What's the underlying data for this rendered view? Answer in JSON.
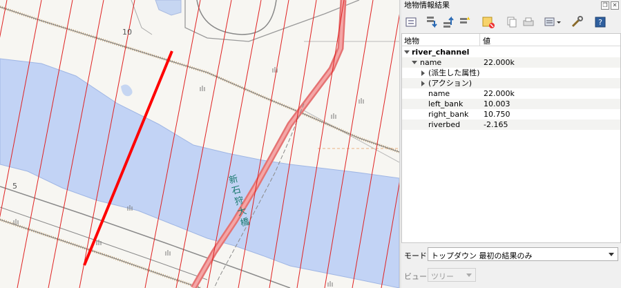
{
  "map": {
    "label_10": "10",
    "label_5": "5",
    "bridge_label": "新石狩大橋"
  },
  "panel": {
    "title": "地物情報結果",
    "toolbar_icons": [
      "expand-tree-icon",
      "expand-all-icon",
      "collapse-all-icon",
      "expand-new-icon",
      "deselect-icon",
      "copy-icon",
      "print-icon",
      "identify-settings-icon",
      "help-icon"
    ],
    "columns": {
      "feature": "地物",
      "value": "値"
    },
    "layer": "river_channel",
    "feature_row": {
      "key": "name",
      "value": "22.000k"
    },
    "derived": "(派生した属性)",
    "actions": "(アクション)",
    "attributes": [
      {
        "key": "name",
        "value": "22.000k"
      },
      {
        "key": "left_bank",
        "value": "10.003"
      },
      {
        "key": "right_bank",
        "value": "10.750"
      },
      {
        "key": "riverbed",
        "value": "-2.165"
      }
    ]
  },
  "mode": {
    "label": "モード",
    "value": "トップダウン 最初の結果のみ"
  },
  "view": {
    "label": "ビュー",
    "value": "ツリー"
  },
  "colors": {
    "selected_line": "#ff0000",
    "section_lines": "#e02020",
    "river": "#c2d3f5",
    "road": "#e57373"
  }
}
